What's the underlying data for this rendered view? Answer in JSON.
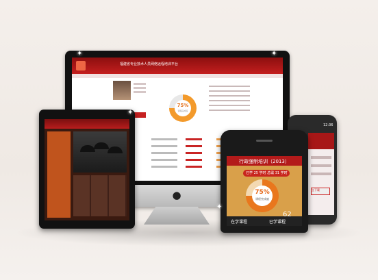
{
  "imac": {
    "site_title": "福建省专业技术人员网络远程培训平台",
    "progress_percent": "75%",
    "progress_label": "课程完成度"
  },
  "phone": {
    "header": "行政强制培训（2013）",
    "chip": "已学 25 学时 总需 31 学时",
    "progress_percent": "75%",
    "progress_label": "课程完成度",
    "big_number": "62",
    "footer_left": "在学课程",
    "footer_right": "已学课程"
  },
  "phone_back": {
    "time": "12:36",
    "button": "立下载"
  },
  "colors": {
    "brand_red": "#c41e1e",
    "progress_orange": "#f39a2b",
    "background": "#f2ede9"
  }
}
